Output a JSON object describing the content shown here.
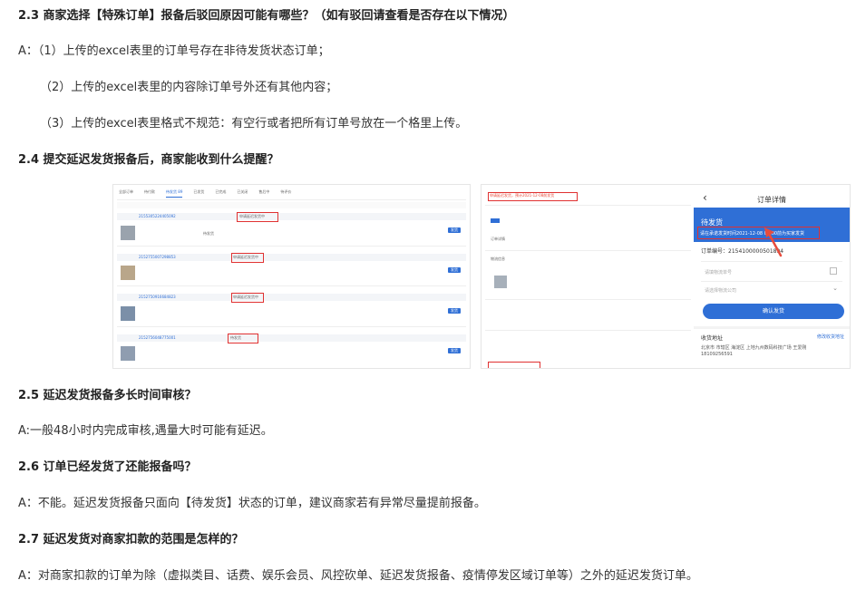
{
  "sections": {
    "q23": {
      "title": "2.3 商家选择【特殊订单】报备后驳回原因可能有哪些？（如有驳回请查看是否存在以下情况）",
      "a1": "A：（1）上传的excel表里的订单号存在非待发货状态订单；",
      "a2": "（2）上传的excel表里的内容除订单号外还有其他内容；",
      "a3": "（3）上传的excel表里格式不规范：有空行或者把所有订单号放在一个格里上传。"
    },
    "q24": {
      "title": "2.4 提交延迟发货报备后，商家能收到什么提醒？"
    },
    "q25": {
      "title": "2.5 延迟发货报备多长时间审核？",
      "a": "A:一般48小时内完成审核,遇量大时可能有延迟。"
    },
    "q26": {
      "title": "2.6 订单已经发货了还能报备吗？",
      "a": "A：不能。延迟发货报备只面向【待发货】状态的订单，建议商家若有异常尽量提前报备。"
    },
    "q27": {
      "title": "2.7 延迟发货对商家扣款的范围是怎样的？",
      "a": "A：对商家扣款的订单为除（虚拟类目、话费、娱乐会员、风控砍单、延迟发货报备、疫情停发区域订单等）之外的延迟发货订单。"
    }
  },
  "screenshots": {
    "left": {
      "tabs": [
        "全部订单",
        "待付款",
        "待发货 89",
        "已发货",
        "已完成",
        "已关闭",
        "售后中",
        "待评价"
      ],
      "order_rows": [
        {
          "order_no": "2155305224405092",
          "tag": "申请延迟发货中"
        },
        {
          "order_no": "2152755007298853",
          "tag": "申请延迟发货中"
        },
        {
          "order_no": "2152750916684823",
          "tag": "申请延迟发货中"
        },
        {
          "order_no": "2152756048775001",
          "tag": "待发货"
        }
      ],
      "status": "待发货",
      "action": "发货"
    },
    "middle": {
      "highlight": "申请延迟发货，预计2021-12-08前发货",
      "links": [
        "订单详情",
        "物流信息"
      ]
    },
    "right": {
      "title": "订单详情",
      "back_icon": "chevron-left-icon",
      "status": "待发货",
      "notice": "请在承诺发货时间2021-12-08 01:00前为买家发货",
      "order_label": "订单编号：",
      "order_no": "2154100000501894",
      "placeholder_tracking": "请填物流单号",
      "placeholder_company": "请选择物流公司",
      "confirm_button": "确认发货",
      "address_label": "收货地址",
      "edit_address": "修改收货地址",
      "address": "北京市 市辖区 海淀区 上地九州数码科技广场 王爱刚",
      "phone": "18109256591"
    }
  },
  "colors": {
    "accent": "#2f6fd6",
    "highlight": "#e03131",
    "arrow": "#e84c3d"
  }
}
